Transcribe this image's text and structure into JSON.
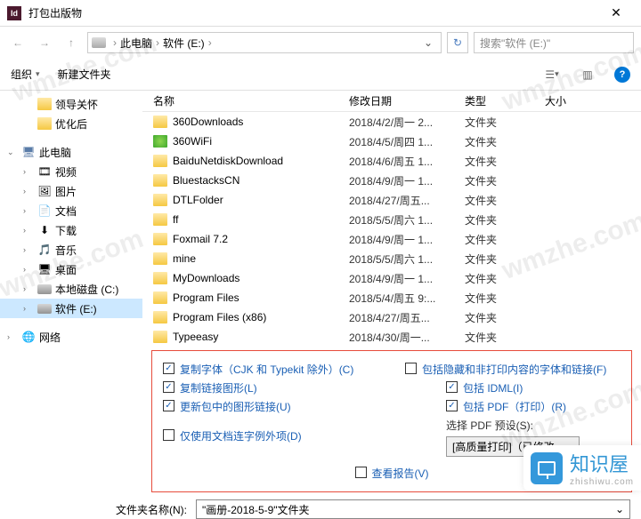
{
  "window": {
    "title": "打包出版物",
    "close": "✕"
  },
  "path": {
    "back": "←",
    "fwd": "→",
    "up": "↑",
    "root": "此电脑",
    "drive": "软件 (E:)",
    "sep": "›",
    "dd": "⌄",
    "refresh": "↻"
  },
  "search": {
    "placeholder": "搜索\"软件 (E:)\""
  },
  "toolbar": {
    "organize": "组织",
    "newfolder": "新建文件夹",
    "dd": "▾",
    "help": "?"
  },
  "tree": {
    "care": "领导关怀",
    "opt": "优化后",
    "pc": "此电脑",
    "video": "视频",
    "pic": "图片",
    "doc": "文档",
    "dl": "下载",
    "music": "音乐",
    "desktop": "桌面",
    "localC": "本地磁盘 (C:)",
    "driveE": "软件 (E:)",
    "net": "网络",
    "caret_r": "›",
    "caret_d": "⌄"
  },
  "cols": {
    "name": "名称",
    "date": "修改日期",
    "type": "类型",
    "size": "大小"
  },
  "files": [
    {
      "n": "360Downloads",
      "d": "2018/4/2/周一 2...",
      "t": "文件夹"
    },
    {
      "n": "360WiFi",
      "d": "2018/4/5/周四 1...",
      "t": "文件夹",
      "sp": true
    },
    {
      "n": "BaiduNetdiskDownload",
      "d": "2018/4/6/周五 1...",
      "t": "文件夹"
    },
    {
      "n": "BluestacksCN",
      "d": "2018/4/9/周一 1...",
      "t": "文件夹"
    },
    {
      "n": "DTLFolder",
      "d": "2018/4/27/周五...",
      "t": "文件夹"
    },
    {
      "n": "ff",
      "d": "2018/5/5/周六 1...",
      "t": "文件夹"
    },
    {
      "n": "Foxmail 7.2",
      "d": "2018/4/9/周一 1...",
      "t": "文件夹"
    },
    {
      "n": "mine",
      "d": "2018/5/5/周六 1...",
      "t": "文件夹"
    },
    {
      "n": "MyDownloads",
      "d": "2018/4/9/周一 1...",
      "t": "文件夹"
    },
    {
      "n": "Program Files",
      "d": "2018/5/4/周五 9:...",
      "t": "文件夹"
    },
    {
      "n": "Program Files (x86)",
      "d": "2018/4/27/周五...",
      "t": "文件夹"
    },
    {
      "n": "Typeeasy",
      "d": "2018/4/30/周一...",
      "t": "文件夹"
    }
  ],
  "opts": {
    "copyFonts": "复制字体（CJK 和 Typekit 除外）(C)",
    "copyLinks": "复制链接图形(L)",
    "updateLinks": "更新包中的图形链接(U)",
    "onlyDocFonts": "仅使用文档连字例外项(D)",
    "includeHidden": "包括隐藏和非打印内容的字体和链接(F)",
    "includeIDML": "包括 IDML(I)",
    "includePDF": "包括 PDF（打印）(R)",
    "presetLabel": "选择 PDF 预设(S):",
    "presetValue": "[高质量打印]（已修改",
    "viewReport": "查看报告(V)"
  },
  "filename": {
    "label": "文件夹名称(N):",
    "value": "\"画册-2018-5-9\"文件夹",
    "dd": "⌄"
  },
  "brand": {
    "wm": "wmzhe.com",
    "name": "知识屋",
    "sub": "zhishiwu.com"
  }
}
